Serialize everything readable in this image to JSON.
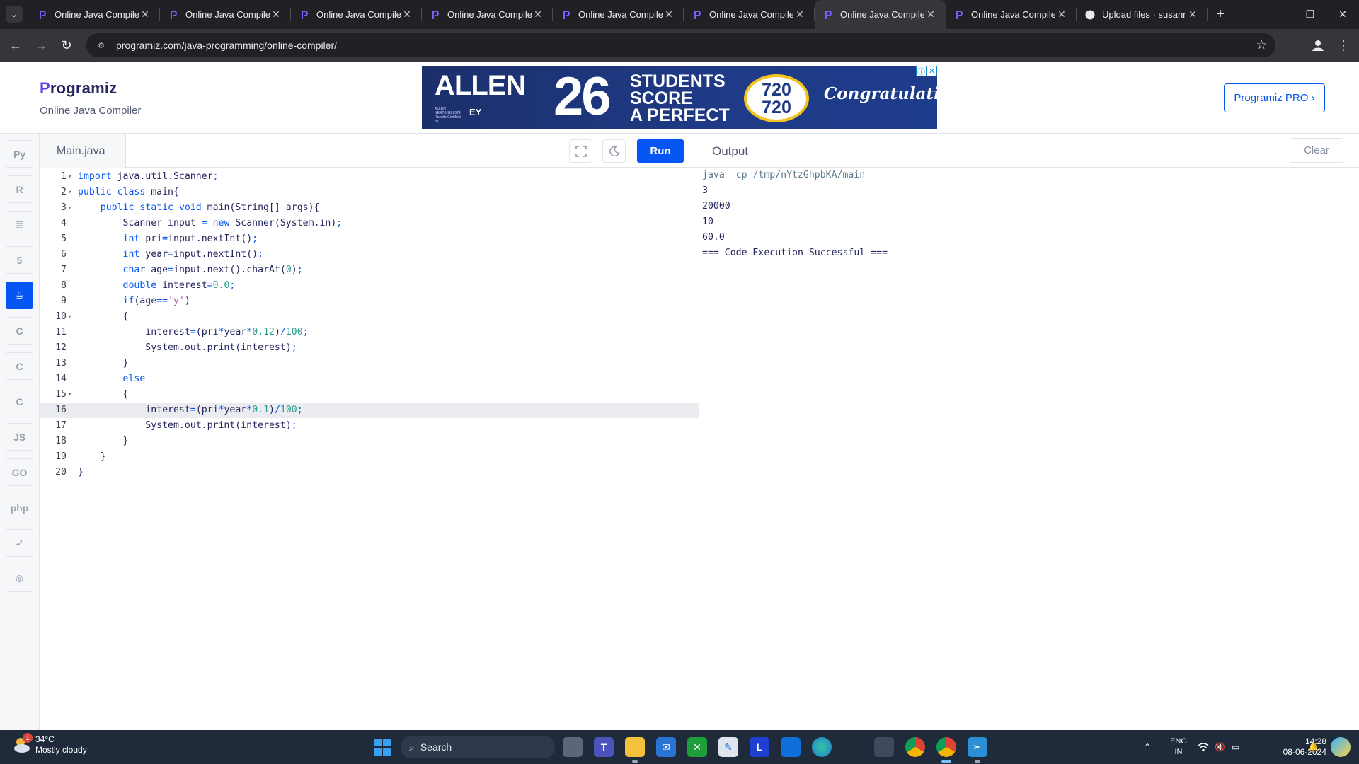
{
  "browser": {
    "tabs": [
      {
        "title": "Online Java Compiler",
        "active": false
      },
      {
        "title": "Online Java Compiler",
        "active": false
      },
      {
        "title": "Online Java Compiler",
        "active": false
      },
      {
        "title": "Online Java Compiler",
        "active": false
      },
      {
        "title": "Online Java Compiler",
        "active": false
      },
      {
        "title": "Online Java Compiler",
        "active": false
      },
      {
        "title": "Online Java Compiler",
        "active": true
      },
      {
        "title": "Online Java Compiler",
        "active": false
      },
      {
        "title": "Upload files · susann",
        "active": false
      }
    ],
    "url": "programiz.com/java-programming/online-compiler/"
  },
  "header": {
    "logo": "Programiz",
    "subtitle": "Online Java Compiler",
    "pro_button": "Programiz PRO ›"
  },
  "ad": {
    "brand": "ALLEN",
    "brand_small": "ALLEN NEET(UG) 2024 Results Certified by",
    "partner": "EY",
    "number": "26",
    "headline_1": "STUDENTS",
    "headline_2": "SCORE",
    "headline_3": "A PERFECT",
    "score_top": "720",
    "score_bottom": "720",
    "tagline": "Congratulations"
  },
  "sidebar": {
    "languages": [
      {
        "name": "python-icon",
        "glyph": "Py"
      },
      {
        "name": "r-icon",
        "glyph": "R"
      },
      {
        "name": "sql-icon",
        "glyph": "≣"
      },
      {
        "name": "html-icon",
        "glyph": "5"
      },
      {
        "name": "java-icon",
        "glyph": "☕",
        "active": true
      },
      {
        "name": "c-icon",
        "glyph": "C"
      },
      {
        "name": "cpp-icon",
        "glyph": "C"
      },
      {
        "name": "csharp-icon",
        "glyph": "C"
      },
      {
        "name": "js-icon",
        "glyph": "JS"
      },
      {
        "name": "go-icon",
        "glyph": "GO"
      },
      {
        "name": "php-icon",
        "glyph": "php"
      },
      {
        "name": "swift-icon",
        "glyph": "➶"
      },
      {
        "name": "rust-icon",
        "glyph": "®"
      }
    ]
  },
  "editor": {
    "file_name": "Main.java",
    "run_label": "Run",
    "current_line": 16,
    "lines": [
      {
        "n": "1",
        "fold": true,
        "code": "import java.util.Scanner;"
      },
      {
        "n": "2",
        "fold": true,
        "code": "public class main{"
      },
      {
        "n": "3",
        "fold": true,
        "code": "    public static void main(String[] args){"
      },
      {
        "n": "4",
        "fold": false,
        "code": "        Scanner input = new Scanner(System.in);"
      },
      {
        "n": "5",
        "fold": false,
        "code": "        int pri=input.nextInt();"
      },
      {
        "n": "6",
        "fold": false,
        "code": "        int year=input.nextInt();"
      },
      {
        "n": "7",
        "fold": false,
        "code": "        char age=input.next().charAt(0);"
      },
      {
        "n": "8",
        "fold": false,
        "code": "        double interest=0.0;"
      },
      {
        "n": "9",
        "fold": false,
        "code": "        if(age=='y')"
      },
      {
        "n": "10",
        "fold": true,
        "code": "        {"
      },
      {
        "n": "11",
        "fold": false,
        "code": "            interest=(pri*year*0.12)/100;"
      },
      {
        "n": "12",
        "fold": false,
        "code": "            System.out.print(interest);"
      },
      {
        "n": "13",
        "fold": false,
        "code": "        }"
      },
      {
        "n": "14",
        "fold": false,
        "code": "        else"
      },
      {
        "n": "15",
        "fold": true,
        "code": "        {"
      },
      {
        "n": "16",
        "fold": false,
        "code": "            interest=(pri*year*0.1)/100;"
      },
      {
        "n": "17",
        "fold": false,
        "code": "            System.out.print(interest);"
      },
      {
        "n": "18",
        "fold": false,
        "code": "        }"
      },
      {
        "n": "19",
        "fold": false,
        "code": "    }"
      },
      {
        "n": "20",
        "fold": false,
        "code": "}"
      }
    ]
  },
  "output": {
    "title": "Output",
    "clear_label": "Clear",
    "lines": [
      "java -cp /tmp/nYtzGhpbKA/main",
      "3",
      "20000",
      "10",
      "60.0",
      "=== Code Execution Successful ==="
    ]
  },
  "taskbar": {
    "temperature": "34°C",
    "weather": "Mostly cloudy",
    "weather_badge": "1",
    "search_placeholder": "Search",
    "language_top": "ENG",
    "language_bottom": "IN",
    "time": "14:28",
    "date": "08-06-2024"
  },
  "colors": {
    "accent": "#0556f3",
    "text_dark": "#25265e",
    "chrome_dark": "#202124",
    "taskbar": "#1f2a3a"
  }
}
